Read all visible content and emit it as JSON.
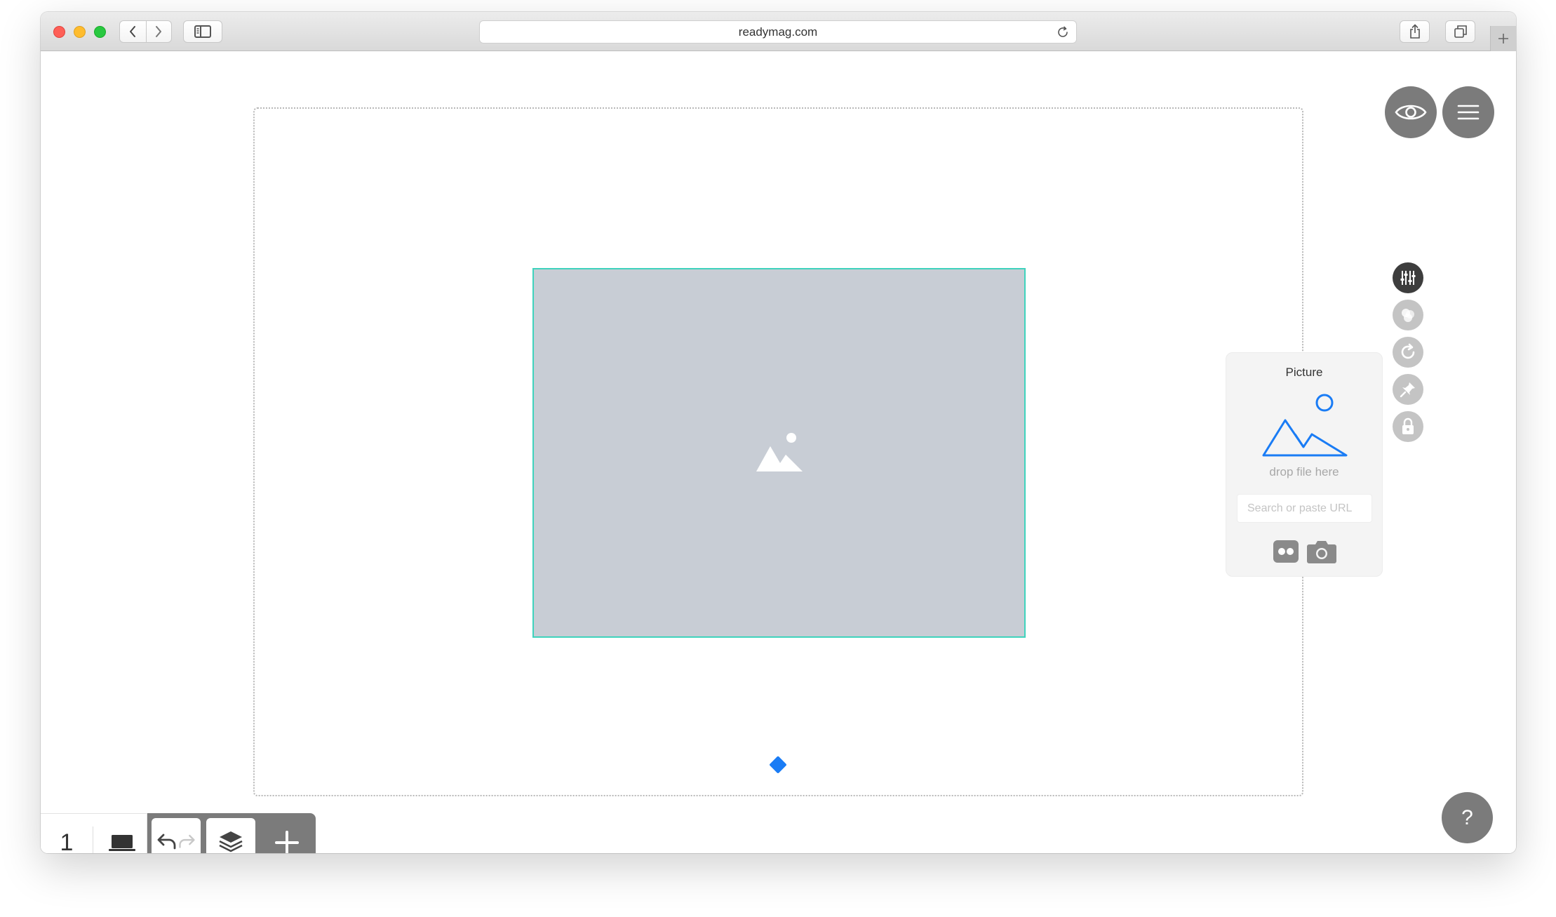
{
  "browser": {
    "url": "readymag.com",
    "icons": {
      "back": "chevron-left-icon",
      "forward": "chevron-right-icon",
      "sidebar": "sidebar-icon",
      "reload": "reload-icon",
      "share": "share-icon",
      "tabs": "tabs-icon",
      "new_tab": "plus-icon"
    }
  },
  "editor": {
    "top_buttons": {
      "preview_icon": "eye-icon",
      "menu_icon": "hamburger-menu-icon"
    },
    "picture_panel": {
      "title": "Picture",
      "drop_hint": "drop file here",
      "url_placeholder": "Search or paste URL",
      "sources": [
        "flickr-icon",
        "camera-icon"
      ]
    },
    "side_tools": [
      "settings-sliders-icon",
      "effects-icon",
      "rotate-icon",
      "pin-icon",
      "lock-icon"
    ],
    "bottom_bar": {
      "page_number": "1",
      "device_icon": "laptop-icon",
      "undo_icon": "undo-icon",
      "redo_icon": "redo-icon",
      "layers_icon": "layers-icon",
      "add_icon": "plus-icon"
    },
    "help_label": "?"
  },
  "colors": {
    "accent_blue": "#1a7cf5",
    "selection_teal": "#3fd3bd",
    "placeholder_fill": "#c8cdd5",
    "control_gray": "#7b7b7b"
  }
}
